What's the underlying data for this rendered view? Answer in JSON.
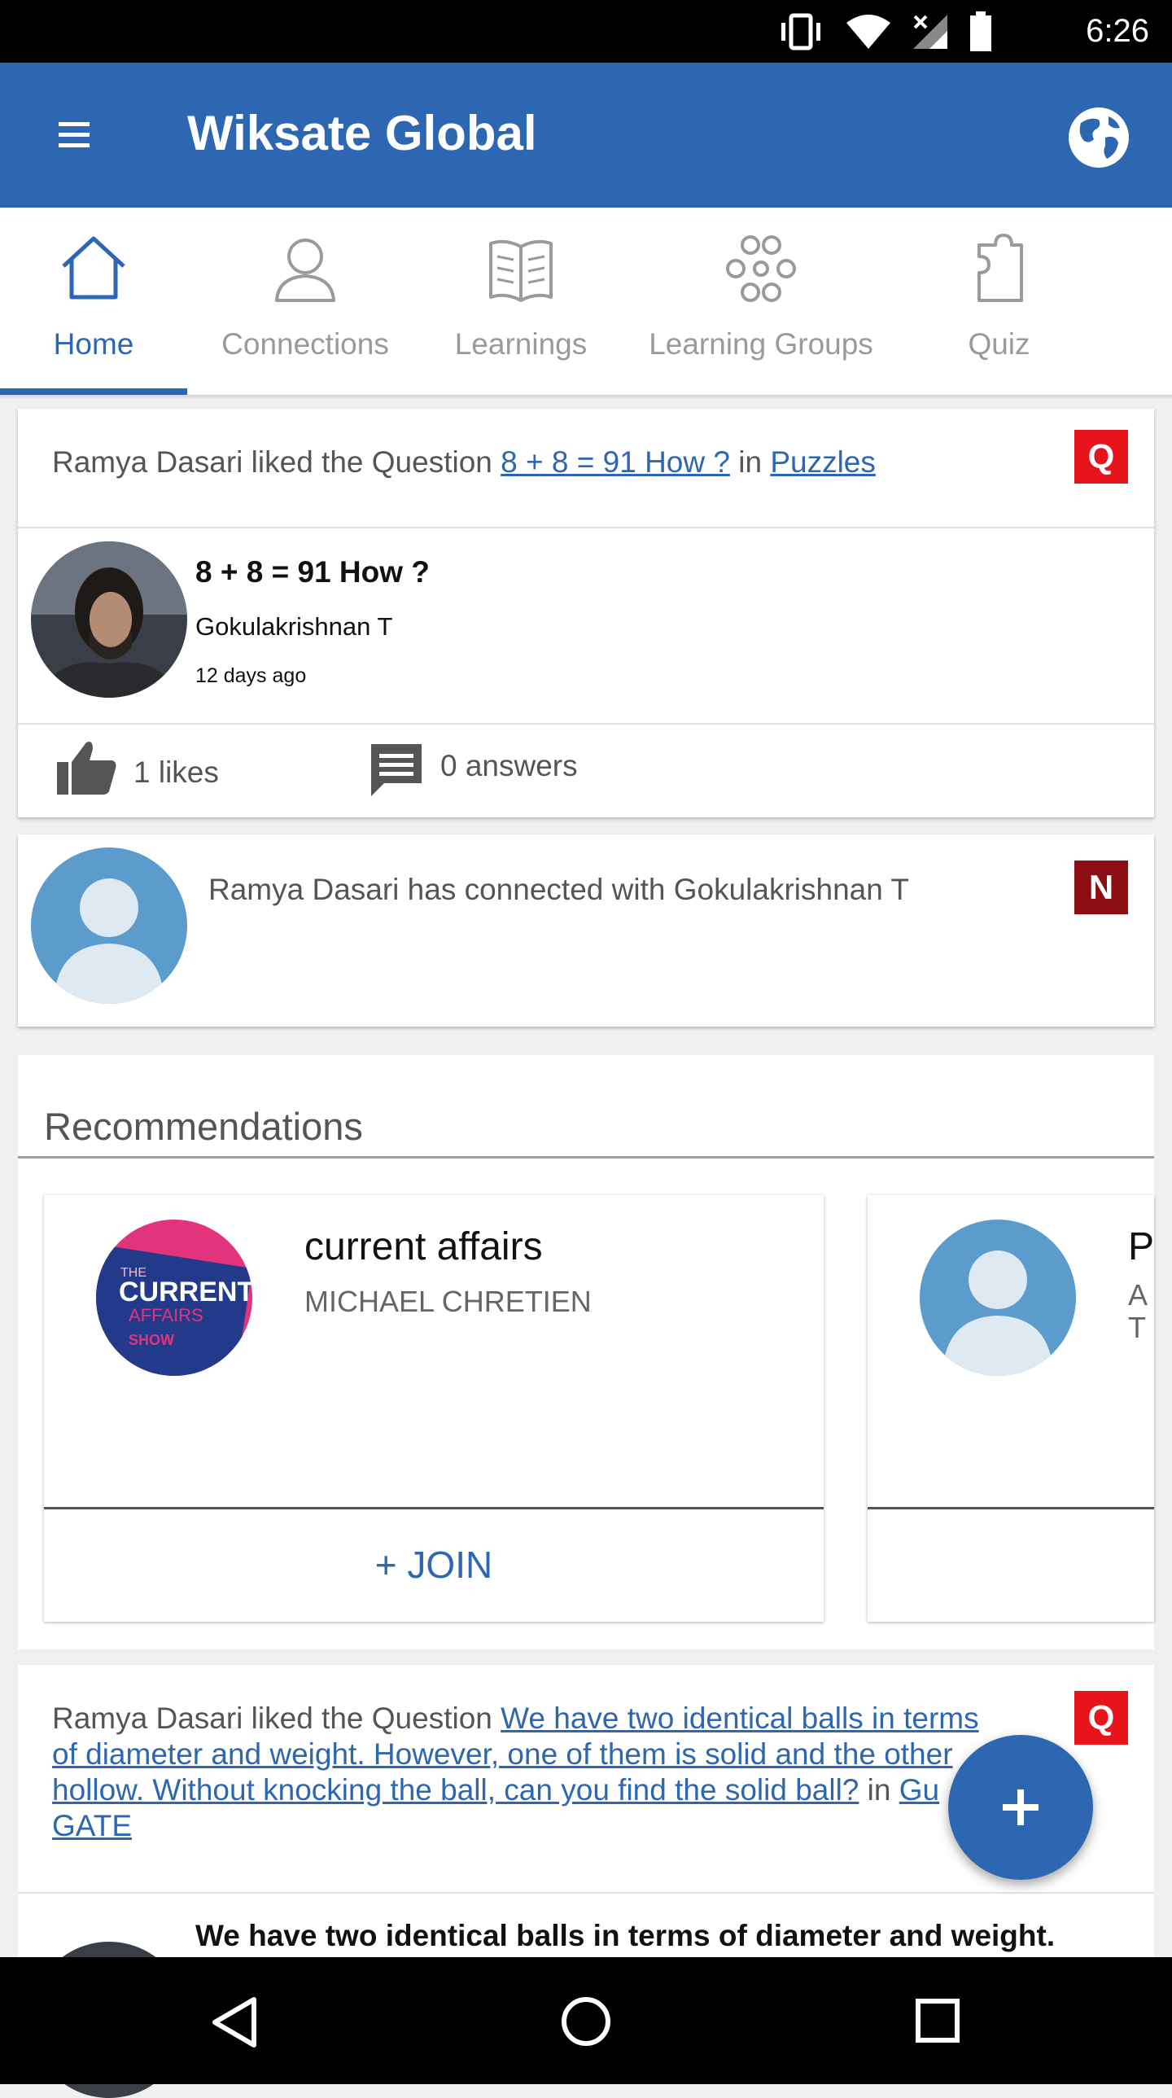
{
  "status_bar": {
    "time": "6:26"
  },
  "app_bar": {
    "title": "Wiksate Global"
  },
  "tabs": [
    {
      "label": "Home",
      "icon": "home-icon"
    },
    {
      "label": "Connections",
      "icon": "person-icon"
    },
    {
      "label": "Learnings",
      "icon": "book-icon"
    },
    {
      "label": "Learning Groups",
      "icon": "group-icon"
    },
    {
      "label": "Quiz",
      "icon": "quiz-icon"
    }
  ],
  "feed": {
    "item1": {
      "prefix": "Ramya Dasari liked the Question ",
      "link": "8 + 8 = 91 How ?",
      "in": " in ",
      "category": "Puzzles",
      "badge": "Q",
      "question_title": "8 + 8 = 91 How ?",
      "author": "Gokulakrishnan T",
      "time": "12 days ago",
      "likes": "1 likes",
      "answers": "0 answers"
    },
    "item2": {
      "text": "Ramya Dasari has connected with Gokulakrishnan T",
      "badge": "N"
    },
    "recommendations": {
      "title": "Recommendations",
      "cards": [
        {
          "name": "current affairs",
          "owner": "MICHAEL CHRETIEN",
          "join": "+ JOIN",
          "logo_text": [
            "THE",
            "CURRENT",
            "AFFAIRS",
            "SHOW"
          ]
        },
        {
          "name": "P",
          "owner_line1": "A",
          "owner_line2": "T"
        }
      ]
    },
    "item3": {
      "prefix": "Ramya Dasari liked the Question ",
      "link_line1": "We have two identical balls in terms",
      "link_line2": "of diameter and weight. However, one of them is solid and the other",
      "link_line3": "hollow. Without knocking the ball, can you find the solid ball?",
      "in": " in ",
      "category_part1": "Gu",
      "category_part2": "GATE",
      "badge": "Q",
      "question_title": "We have two identical balls in terms of diameter and weight."
    }
  },
  "fab": {
    "label": "+"
  },
  "colors": {
    "primary": "#2d67b1",
    "badge_q": "#e8141b",
    "badge_n": "#8c0e12"
  }
}
